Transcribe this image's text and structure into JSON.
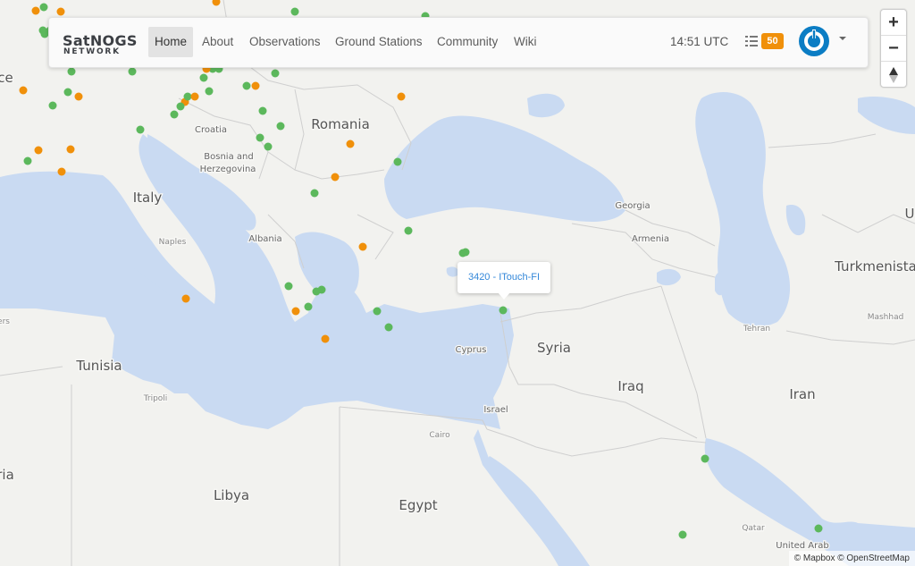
{
  "brand": {
    "line1": "SatNOGS",
    "line2": "NETWORK"
  },
  "nav": {
    "items": [
      {
        "label": "Home",
        "active": true
      },
      {
        "label": "About"
      },
      {
        "label": "Observations"
      },
      {
        "label": "Ground Stations"
      },
      {
        "label": "Community"
      },
      {
        "label": "Wiki"
      }
    ]
  },
  "header": {
    "clock": "14:51 UTC",
    "jobs_icon": "list-icon",
    "jobs_badge": "50",
    "badge_color": "#f0900a",
    "avatar_icon": "power-icon",
    "avatar_color": "#0b7dc4",
    "menu_icon": "caret-down-icon"
  },
  "zoom": {
    "in_label": "+",
    "out_label": "−",
    "reset_icon": "compass-icon"
  },
  "popup": {
    "text": "3420 - ITouch-FI"
  },
  "attribution": "© Mapbox © OpenStreetMap",
  "map": {
    "water_color": "#c9daf2",
    "land_color": "#f2f2ef",
    "marker_colors": {
      "online": "#5cb85c",
      "testing": "#f0900a"
    },
    "labels": [
      {
        "text": "Romania",
        "kind": "country"
      },
      {
        "text": "Croatia",
        "kind": "region"
      },
      {
        "text": "Bosnia and",
        "kind": "region"
      },
      {
        "text": "Herzegovina",
        "kind": "region"
      },
      {
        "text": "Italy",
        "kind": "country"
      },
      {
        "text": "Naples",
        "kind": "city"
      },
      {
        "text": "Albania",
        "kind": "region"
      },
      {
        "text": "Georgia",
        "kind": "region"
      },
      {
        "text": "Armenia",
        "kind": "region"
      },
      {
        "text": "Turkmenista",
        "kind": "country"
      },
      {
        "text": "Mashhad",
        "kind": "city"
      },
      {
        "text": "Tehran",
        "kind": "city"
      },
      {
        "text": "Syria",
        "kind": "country"
      },
      {
        "text": "Cyprus",
        "kind": "region"
      },
      {
        "text": "Iraq",
        "kind": "country"
      },
      {
        "text": "Iran",
        "kind": "country"
      },
      {
        "text": "Tunisia",
        "kind": "country"
      },
      {
        "text": "Tripoli",
        "kind": "city"
      },
      {
        "text": "Israel",
        "kind": "region"
      },
      {
        "text": "Cairo",
        "kind": "city"
      },
      {
        "text": "Libya",
        "kind": "country"
      },
      {
        "text": "Egypt",
        "kind": "country"
      },
      {
        "text": "Qatar",
        "kind": "city"
      },
      {
        "text": "United Arab",
        "kind": "region"
      },
      {
        "text": "ce",
        "kind": "country"
      },
      {
        "text": "ria",
        "kind": "country"
      },
      {
        "text": "ers",
        "kind": "city"
      },
      {
        "text": "U",
        "kind": "country"
      }
    ],
    "stations": [
      {
        "status": "testing"
      },
      {
        "status": "online"
      },
      {
        "status": "testing"
      },
      {
        "status": "online"
      },
      {
        "status": "testing"
      },
      {
        "status": "online"
      },
      {
        "status": "online"
      },
      {
        "status": "testing"
      },
      {
        "status": "online"
      },
      {
        "status": "online"
      },
      {
        "status": "online"
      },
      {
        "status": "testing"
      },
      {
        "status": "online"
      },
      {
        "status": "online"
      },
      {
        "status": "testing"
      },
      {
        "status": "testing"
      },
      {
        "status": "online"
      },
      {
        "status": "online"
      },
      {
        "status": "testing"
      },
      {
        "status": "online"
      },
      {
        "status": "online"
      },
      {
        "status": "online"
      },
      {
        "status": "online"
      },
      {
        "status": "testing"
      },
      {
        "status": "online"
      },
      {
        "status": "online"
      },
      {
        "status": "testing"
      },
      {
        "status": "testing"
      },
      {
        "status": "online"
      },
      {
        "status": "testing"
      },
      {
        "status": "online"
      },
      {
        "status": "online"
      },
      {
        "status": "online"
      },
      {
        "status": "online"
      },
      {
        "status": "online"
      },
      {
        "status": "online"
      },
      {
        "status": "testing"
      },
      {
        "status": "testing"
      },
      {
        "status": "online"
      },
      {
        "status": "online"
      },
      {
        "status": "testing"
      },
      {
        "status": "testing"
      },
      {
        "status": "online"
      },
      {
        "status": "online"
      },
      {
        "status": "online"
      },
      {
        "status": "online"
      },
      {
        "status": "testing"
      },
      {
        "status": "online"
      },
      {
        "status": "online"
      },
      {
        "status": "testing"
      },
      {
        "status": "online"
      },
      {
        "status": "online"
      },
      {
        "status": "online"
      },
      {
        "status": "online"
      },
      {
        "status": "online"
      },
      {
        "status": "online"
      },
      {
        "status": "online"
      },
      {
        "status": "testing"
      },
      {
        "status": "online"
      }
    ]
  }
}
